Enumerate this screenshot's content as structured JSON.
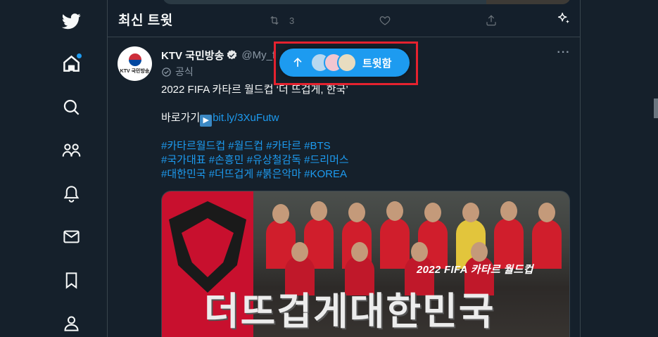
{
  "window": {
    "width": 935,
    "height": 479
  },
  "nav": {
    "items": [
      {
        "name": "twitter-logo",
        "icon": "twitter-bird-icon"
      },
      {
        "name": "home",
        "icon": "home-icon"
      },
      {
        "name": "explore",
        "icon": "search-icon"
      },
      {
        "name": "communities",
        "icon": "communities-icon"
      },
      {
        "name": "notifications",
        "icon": "bell-icon"
      },
      {
        "name": "messages",
        "icon": "mail-icon"
      },
      {
        "name": "bookmarks",
        "icon": "bookmark-icon"
      },
      {
        "name": "profile",
        "icon": "person-icon"
      }
    ]
  },
  "header": {
    "title": "최신 트윗",
    "prev_retweet_count": "3",
    "sparkle_icon": "sparkle-icon"
  },
  "tweet": {
    "avatar_text": "KTV 국민방송",
    "author_name": "KTV 국민방송",
    "handle": "@My_f",
    "official_label": "공식",
    "more_label": "···",
    "line1": "2022 FIFA 카타르 월드컵 ‘더 뜨겁게, 한국’",
    "shortcut_prefix": "바로가기",
    "shortcut_arrow": "▶",
    "shortcut_link": "bit.ly/3XuFutw",
    "hashtags_line1": "#카타르월드컵 #월드컵 #카타르 #BTS",
    "hashtags_line2": "#국가대표 #손흥민 #유상철감독 #드리머스",
    "hashtags_line3": "#대한민국 #더뜨겁게 #붉은악마 #KOREA",
    "media_caption": "2022 FIFA 카타르 월드컵",
    "media_slogan": "더뜨겁게대한민국"
  },
  "new_tweets_pill": {
    "label": "트윗함",
    "arrow_icon": "arrow-up-icon",
    "avatar_colors": [
      "#b8d8f0",
      "#f2c6d0",
      "#e8dcc0"
    ]
  },
  "colors": {
    "background": "#15202b",
    "border": "#38444d",
    "accent": "#1d9bf0",
    "secondary_text": "#8b98a5",
    "highlight": "#e5222f"
  }
}
